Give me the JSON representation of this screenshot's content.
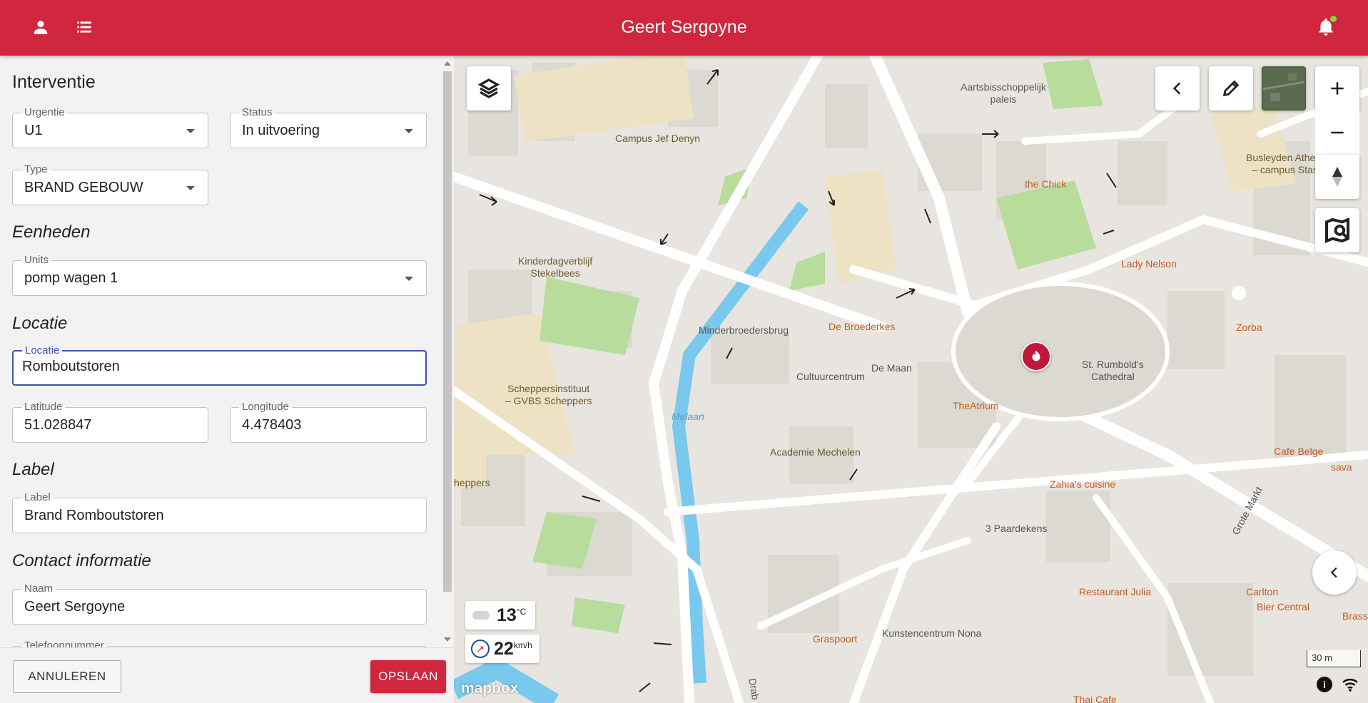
{
  "header": {
    "title": "Geert Sergoyne",
    "icons": [
      "person-icon",
      "list-icon",
      "bell-icon"
    ]
  },
  "form": {
    "section_title": "Interventie",
    "urgentie": {
      "label": "Urgentie",
      "value": "U1"
    },
    "status": {
      "label": "Status",
      "value": "In uitvoering"
    },
    "type": {
      "label": "Type",
      "value": "BRAND GEBOUW"
    },
    "eenheden_title": "Eenheden",
    "units": {
      "label": "Units",
      "value": "pomp wagen 1"
    },
    "locatie_title": "Locatie",
    "locatie": {
      "label": "Locatie",
      "value": "Romboutstoren"
    },
    "latitude": {
      "label": "Latitude",
      "value": "51.028847"
    },
    "longitude": {
      "label": "Longitude",
      "value": "4.478403"
    },
    "label_title": "Label",
    "label_field": {
      "label": "Label",
      "value": "Brand Romboutstoren"
    },
    "contact_title": "Contact informatie",
    "naam": {
      "label": "Naam",
      "value": "Geert Sergoyne"
    },
    "telefoon": {
      "label": "Telefoonnummer"
    }
  },
  "footer": {
    "cancel": "ANNULEREN",
    "save": "OPSLAAN"
  },
  "map": {
    "labels": [
      {
        "text": "Aartsbisschoppelijk\npaleis",
        "kind": "place"
      },
      {
        "text": "Campus Jef Denyn",
        "kind": "edu"
      },
      {
        "text": "the Chick",
        "kind": "poi"
      },
      {
        "text": "Busleyden Atheneum\n– campus Stassart",
        "kind": "edu"
      },
      {
        "text": "Kinderdagverblijf\nStekelbees",
        "kind": "edu"
      },
      {
        "text": "Lady Nelson",
        "kind": "poi"
      },
      {
        "text": "Minderbroedersbrug",
        "kind": "place"
      },
      {
        "text": "De Broederkes",
        "kind": "poi"
      },
      {
        "text": "Zorba",
        "kind": "poi"
      },
      {
        "text": "Cultuurcentrum",
        "kind": "place"
      },
      {
        "text": "De Maan",
        "kind": "place"
      },
      {
        "text": "St. Rumbold's\nCathedral",
        "kind": "place"
      },
      {
        "text": "Scheppersinstituut\n– GVBS Scheppers",
        "kind": "edu"
      },
      {
        "text": "TheAtrium",
        "kind": "poi"
      },
      {
        "text": "Melaan",
        "kind": "water"
      },
      {
        "text": "Academie Mechelen",
        "kind": "edu"
      },
      {
        "text": "Cafe Belge",
        "kind": "poi"
      },
      {
        "text": "sava",
        "kind": "poi"
      },
      {
        "text": "heppers",
        "kind": "edu"
      },
      {
        "text": "Zahia's cuisine",
        "kind": "poi"
      },
      {
        "text": "Grote Markt",
        "kind": "place"
      },
      {
        "text": "3 Paardekens",
        "kind": "place"
      },
      {
        "text": "Restaurant Julia",
        "kind": "poi"
      },
      {
        "text": "Carlton",
        "kind": "poi"
      },
      {
        "text": "Bier Central",
        "kind": "poi"
      },
      {
        "text": "Brasse",
        "kind": "poi"
      },
      {
        "text": "Graspoort",
        "kind": "poi"
      },
      {
        "text": "Kunstencentrum Nona",
        "kind": "place"
      },
      {
        "text": "Thai Cafe",
        "kind": "poi"
      },
      {
        "text": "Drab",
        "kind": "place"
      }
    ],
    "weather": {
      "temp": "13",
      "unit": "°C"
    },
    "wind": {
      "speed": "22",
      "unit": "km/h"
    },
    "scale": "30 m",
    "attribution": "mapbox"
  }
}
